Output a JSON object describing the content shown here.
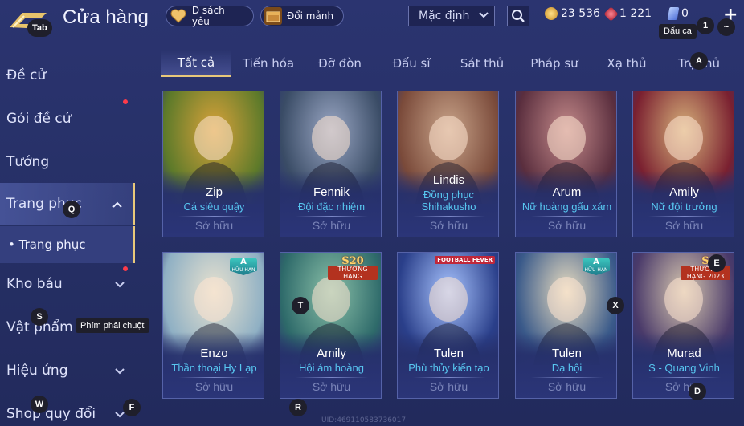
{
  "header": {
    "title": "Cửa hàng",
    "wishlist_label": "D sách yêu",
    "exchange_label": "Đổi mảnh",
    "sort_value": "Mặc định",
    "currencies": [
      {
        "name": "gold-coin",
        "value": "23 536",
        "color": "#e9b43a"
      },
      {
        "name": "ruby",
        "value": "1 221",
        "color": "#d2384a"
      },
      {
        "name": "voucher",
        "value": "0",
        "color": "#7fa6ff"
      }
    ]
  },
  "hotkeys": {
    "tab": "Tab",
    "one": "1",
    "tilde": "~",
    "a": "A",
    "q": "Q",
    "s": "S",
    "t": "T",
    "x": "X",
    "e": "E",
    "d": "D",
    "w": "W",
    "f": "F",
    "r": "R"
  },
  "tooltips": {
    "dau_ca": "Dấu ca",
    "right_mouse": "Phím phải chuột"
  },
  "sidebar": {
    "items": [
      {
        "label": "Đề cử"
      },
      {
        "label": "Gói đề cử"
      },
      {
        "label": "Tướng"
      },
      {
        "label": "Trang phục"
      },
      {
        "label": "Kho báu"
      },
      {
        "label": "Vật phẩm"
      },
      {
        "label": "Hiệu ứng"
      },
      {
        "label": "Shop quy đổi"
      }
    ],
    "sub_item": "• Trang phục"
  },
  "tabs": [
    "Tất cả",
    "Tiến hóa",
    "Đỡ đòn",
    "Đấu sĩ",
    "Sát thủ",
    "Pháp sư",
    "Xạ thủ",
    "Trợ thủ"
  ],
  "cards": [
    {
      "hero": "Zip",
      "skin": "Cá siêu quậy",
      "owned": "Sở hữu",
      "art": [
        "#5d7a2a",
        "#d9a23a"
      ]
    },
    {
      "hero": "Fennik",
      "skin": "Đội đặc nhiệm",
      "owned": "Sở hữu",
      "art": [
        "#3a4c66",
        "#9aa7c4"
      ]
    },
    {
      "hero": "Lindis",
      "skin": "Đồng phục Shihakusho",
      "owned": "Sở hữu",
      "art": [
        "#7a4a3a",
        "#c9a48a"
      ]
    },
    {
      "hero": "Arum",
      "skin": "Nữ hoàng gấu xám",
      "owned": "Sở hữu",
      "art": [
        "#5a2e3e",
        "#c48a8a"
      ]
    },
    {
      "hero": "Amily",
      "skin": "Nữ đội trưởng",
      "owned": "Sở hữu",
      "art": [
        "#7a2030",
        "#d6b07a"
      ]
    },
    {
      "hero": "Enzo",
      "skin": "Thần thoại Hy Lạp",
      "owned": "Sở hữu",
      "art": [
        "#8fb0c4",
        "#e8e2d0"
      ],
      "badge": "A",
      "badge_sub": "HỮU HẠN"
    },
    {
      "hero": "Amily",
      "skin": "Hội ám hoàng",
      "owned": "Sở hữu",
      "art": [
        "#2e6a6a",
        "#8ac0a8"
      ],
      "season": "S20",
      "season_sub": "THƯỜNG HẠNG"
    },
    {
      "hero": "Tulen",
      "skin": "Phù thủy kiến tạo",
      "owned": "Sở hữu",
      "art": [
        "#2a3f8a",
        "#a8c4ff"
      ],
      "top_badge": "FOOTBALL FEVER"
    },
    {
      "hero": "Tulen",
      "skin": "Dạ hội",
      "owned": "Sở hữu",
      "art": [
        "#3a5a8a",
        "#e8dcc0"
      ],
      "badge": "A",
      "badge_sub": "HỮU HẠN"
    },
    {
      "hero": "Murad",
      "skin": "S - Quang Vinh",
      "owned": "Sở hữu",
      "art": [
        "#4a3a6a",
        "#d8c8b0"
      ],
      "season": "S",
      "season_sub": "THƯỜNG HẠNG 2023"
    }
  ],
  "uid_text": "UID:469110583736017",
  "colors": {
    "accent_gold": "#e9c97a",
    "skin_cyan": "#58c7f0",
    "owned_gray": "#7a84b8"
  }
}
